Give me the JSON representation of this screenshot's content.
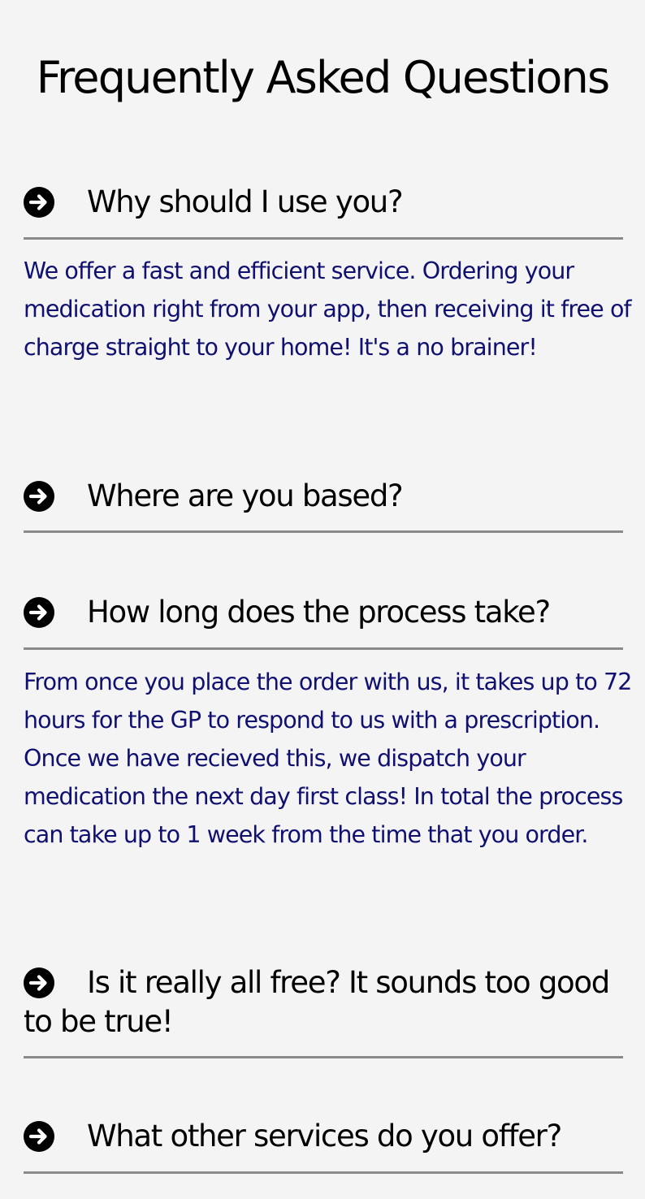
{
  "page": {
    "title": "Frequently Asked Questions"
  },
  "colors": {
    "background": "#f4f4f4",
    "question_text": "#000000",
    "answer_text": "#101070",
    "divider": "#8a8a8a",
    "icon": "#000000"
  },
  "faq": {
    "icon": "arrow-right-circle-icon",
    "items": [
      {
        "question": "Why should I use you?",
        "expanded": true,
        "answer": "We offer a fast and efficient service. Ordering your medication right from your app, then receiving it free of charge straight to your home! It's a no brainer!"
      },
      {
        "question": "Where are you based?",
        "expanded": false,
        "answer": ""
      },
      {
        "question": "How long does the process take?",
        "expanded": true,
        "answer": "From once you place the order with us, it takes up to 72 hours for the GP to respond to us with a prescription. Once we have recieved this, we dispatch your medication the next day first class! In total the process can take up to 1 week from the time that you order."
      },
      {
        "question": "Is it really all free? It sounds too good to be true!",
        "expanded": false,
        "answer": ""
      },
      {
        "question": "What other services do you offer?",
        "expanded": false,
        "answer": ""
      }
    ]
  }
}
